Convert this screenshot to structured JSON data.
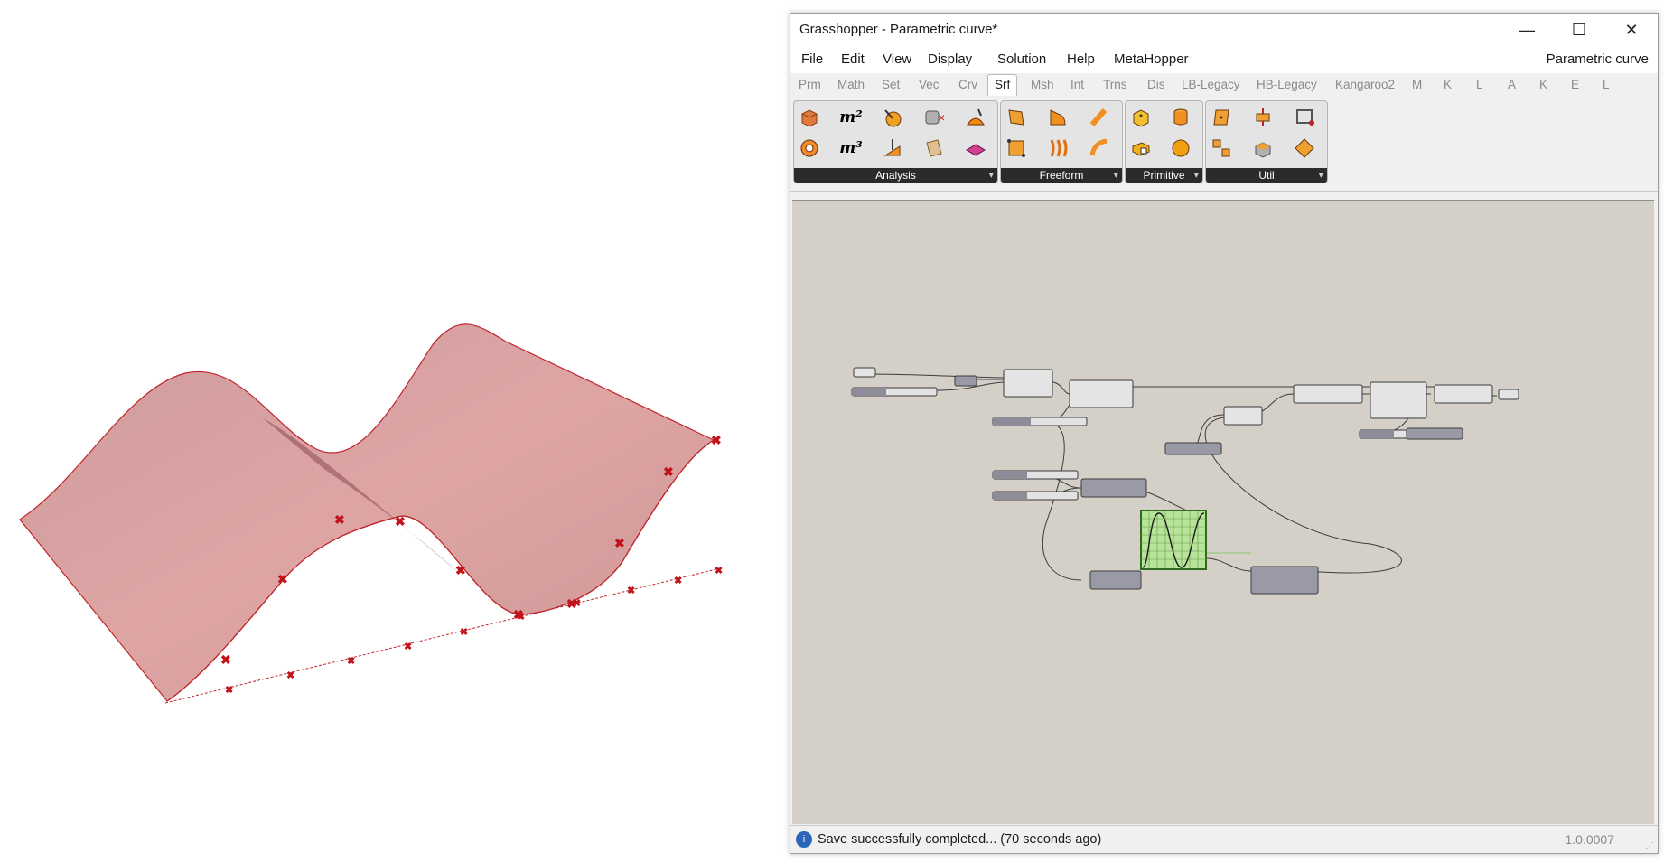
{
  "window": {
    "title": "Grasshopper - Parametric curve*",
    "document_name": "Parametric curve",
    "minimize_symbol": "—",
    "maximize_symbol": "☐",
    "close_symbol": "✕"
  },
  "menu": {
    "items": [
      "File",
      "Edit",
      "View",
      "Display",
      "Solution",
      "Help",
      "MetaHopper"
    ]
  },
  "tabs": {
    "items": [
      "Prm",
      "Math",
      "Set",
      "Vec",
      "Crv",
      "Srf",
      "Msh",
      "Int",
      "Trns",
      "Dis",
      "LB-Legacy",
      "HB-Legacy",
      "Kangaroo2",
      "M",
      "K",
      "L",
      "A",
      "K",
      "E",
      "L"
    ],
    "active": "Srf"
  },
  "toolbar": {
    "panels": [
      {
        "label": "Analysis"
      },
      {
        "label": "Freeform"
      },
      {
        "label": "Primitive"
      },
      {
        "label": "Util"
      }
    ],
    "analysis_area_label": "m²",
    "analysis_volume_label": "m³",
    "expand_symbol": "▾"
  },
  "status": {
    "icon": "info-icon",
    "text": "Save successfully completed... (70 seconds ago)",
    "version": "1.0.0007",
    "grip": "⋰"
  },
  "colors": {
    "surface_fill": "#c98585",
    "surface_edge": "#c0262d",
    "point_marker": "#c0141a",
    "canvas_bg": "#d4d0c8",
    "component_fill": "#9a99a6",
    "graph_fill": "#b8e39a"
  }
}
